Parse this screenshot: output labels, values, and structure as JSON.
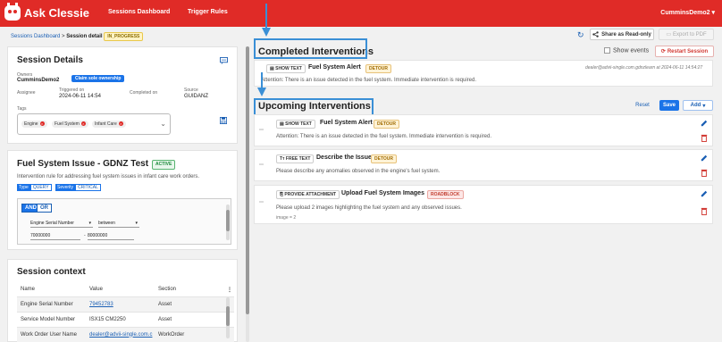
{
  "app": {
    "brand": "Ask Clessie",
    "nav": [
      "Sessions Dashboard",
      "Trigger Rules"
    ],
    "user": "CumminsDemo2"
  },
  "breadcrumb": {
    "parent": "Sessions Dashboard",
    "separator": ">",
    "current": "Session detail",
    "status": "IN_PROGRESS"
  },
  "toolbar": {
    "share_label": "Share as Read-only",
    "export_label": "Export to PDF",
    "show_events_label": "Show events",
    "restart_label": "Restart Session"
  },
  "session_details": {
    "title": "Session Details",
    "owners_label": "Owners",
    "owners_value": "CumminsDemo2",
    "claim_label": "Claim sole ownership",
    "assignee_label": "Assignee",
    "triggered_label": "Triggered on",
    "triggered_value": "2024-06-11 14:54",
    "completed_label": "Completed on",
    "source_label": "Source",
    "source_value": "GUIDANZ",
    "tags_label": "Tags",
    "tags": [
      "Engine",
      "Fuel System",
      "Infant Care"
    ]
  },
  "rule": {
    "title": "Fuel System Issue - GDNZ Test",
    "status": "ACTIVE",
    "description": "Intervention rule for addressing fuel system issues in infant care work orders.",
    "type_label": "Type",
    "type_value": "QUERY",
    "severity_label": "Severity",
    "severity_value": "CRITICAL",
    "and_label": "AND",
    "or_label": "OR",
    "field": "Engine Serial Number",
    "operator": "between",
    "from_value": "70000000",
    "to_value": "80000000"
  },
  "context": {
    "title": "Session context",
    "columns": [
      "Name",
      "Value",
      "Section"
    ],
    "rows": [
      {
        "name": "Engine Serial Number",
        "value": "79452783",
        "section": "Asset",
        "link": true
      },
      {
        "name": "Service Model Number",
        "value": "ISX15 CM2250",
        "section": "Asset",
        "link": false
      },
      {
        "name": "Work Order User Name",
        "value": "dealer@advii-single.com.c",
        "section": "WorkOrder",
        "link": true
      }
    ]
  },
  "completed": {
    "title": "Completed Interventions",
    "items": [
      {
        "type": "SHOW TEXT",
        "title": "Fuel System Alert",
        "chip": "DETOUR",
        "meta": "dealer@advii-single.com.gdnzlearn at 2024-06-11 14:54:27",
        "desc": "Attention: There is an issue detected in the fuel system. Immediate intervention is required."
      }
    ]
  },
  "upcoming": {
    "title": "Upcoming Interventions",
    "reset_label": "Reset",
    "save_label": "Save",
    "add_label": "Add",
    "items": [
      {
        "type": "SHOW TEXT",
        "title": "Fuel System Alert",
        "chip": "DETOUR",
        "desc": "Attention: There is an issue detected in the fuel system. Immediate intervention is required."
      },
      {
        "type": "FREE TEXT",
        "title": "Describe the Issue",
        "chip": "DETOUR",
        "desc": "Please describe any anomalies observed in the engine's fuel system."
      },
      {
        "type": "PROVIDE ATTACHMENT",
        "title": "Upload Fuel System Images",
        "chip": "ROADBLOCK",
        "desc": "Please upload 2 images highlighting the fuel system and any observed issues.",
        "meta": "image = 2"
      }
    ]
  },
  "colors": {
    "brand_red": "#e02b27",
    "primary_blue": "#1a73e8",
    "highlight_box": "#3a8fd6"
  }
}
